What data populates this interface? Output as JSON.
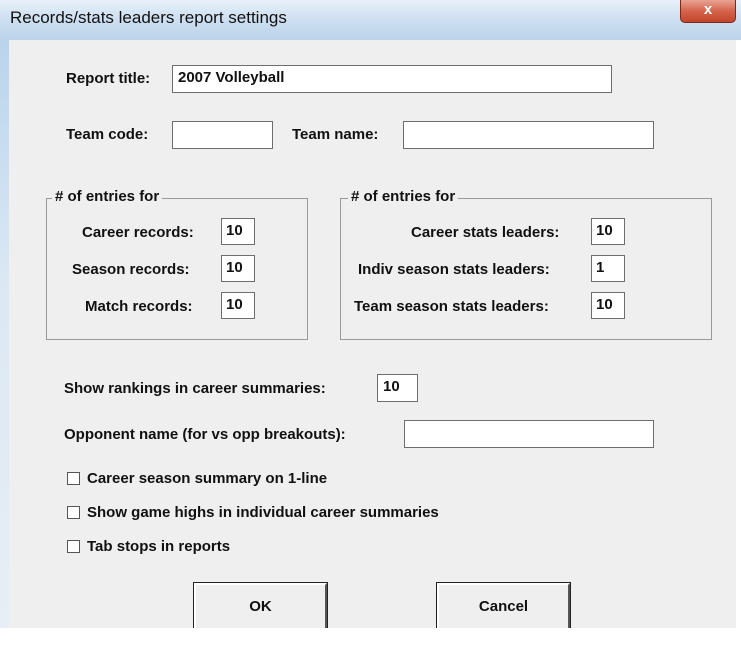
{
  "window": {
    "title": "Records/stats leaders report settings",
    "close_glyph": "x"
  },
  "report_title": {
    "label": "Report title:",
    "value": "2007 Volleyball"
  },
  "team_code": {
    "label": "Team code:",
    "value": ""
  },
  "team_name": {
    "label": "Team name:",
    "value": ""
  },
  "records_group": {
    "legend": "# of entries for",
    "career": {
      "label": "Career records:",
      "value": "10"
    },
    "season": {
      "label": "Season records:",
      "value": "10"
    },
    "match": {
      "label": "Match records:",
      "value": "10"
    }
  },
  "stats_group": {
    "legend": "# of entries for",
    "career": {
      "label": "Career stats leaders:",
      "value": "10"
    },
    "indiv_season": {
      "label": "Indiv season stats leaders:",
      "value": "1"
    },
    "team_season": {
      "label": "Team season stats leaders:",
      "value": "10"
    }
  },
  "show_rankings": {
    "label": "Show rankings in career summaries:",
    "value": "10"
  },
  "opponent_name": {
    "label": "Opponent name (for vs opp breakouts):",
    "value": ""
  },
  "checkboxes": [
    {
      "label": "Career season summary on 1-line",
      "checked": false
    },
    {
      "label": "Show game highs in individual career summaries",
      "checked": false
    },
    {
      "label": "Tab stops in reports",
      "checked": false
    }
  ],
  "buttons": {
    "ok": "OK",
    "cancel": "Cancel"
  }
}
